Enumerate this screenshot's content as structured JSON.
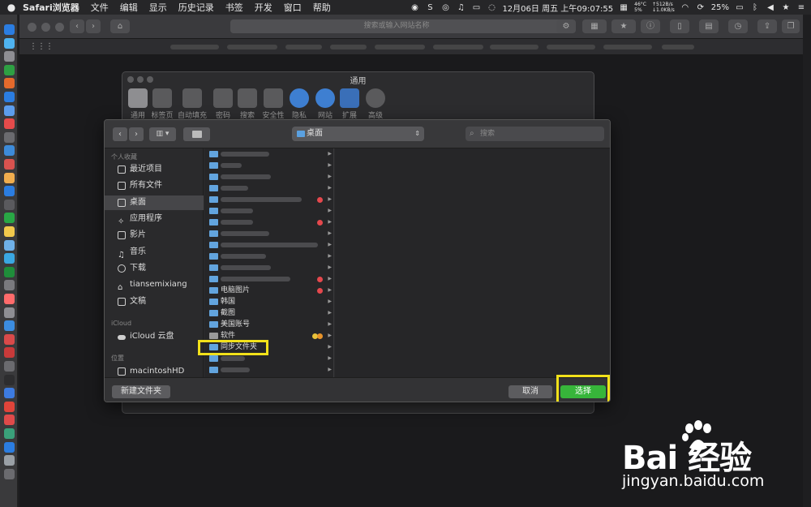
{
  "menubar": {
    "app_name": "Safari浏览器",
    "menus": [
      "文件",
      "编辑",
      "显示",
      "历史记录",
      "书签",
      "开发",
      "窗口",
      "帮助"
    ],
    "temperature": "46°C",
    "cpu_usage": "5%",
    "net_up": "↑512B/s",
    "net_down": "↓1.0KB/s",
    "battery": "25%",
    "datetime": "12月06日 周五 上午09:07:55"
  },
  "safari": {
    "address_placeholder": "搜索或输入网站名称"
  },
  "prefs": {
    "title": "通用",
    "tabs": [
      "通用",
      "标签页",
      "自动填充",
      "密码",
      "搜索",
      "安全性",
      "隐私",
      "网站",
      "扩展",
      "高级"
    ]
  },
  "panel": {
    "location": "桌面",
    "search_placeholder": "搜索",
    "sidebar": {
      "favorites_head": "个人收藏",
      "favorites": [
        "最近项目",
        "所有文件",
        "桌面",
        "应用程序",
        "影片",
        "音乐",
        "下载",
        "tiansemixiang",
        "文稿"
      ],
      "icloud_head": "iCloud",
      "icloud_items": [
        "iCloud 云盘"
      ],
      "locations_head": "位置",
      "locations": [
        "macintoshHD"
      ]
    },
    "files": [
      "电脑图片",
      "韩国",
      "截图",
      "美国账号",
      "软件",
      "同步文件夹"
    ],
    "new_folder_label": "新建文件夹",
    "cancel_label": "取消",
    "choose_label": "选择"
  },
  "watermark": {
    "logo": "Bai 经验",
    "url": "jingyan.baidu.com"
  }
}
